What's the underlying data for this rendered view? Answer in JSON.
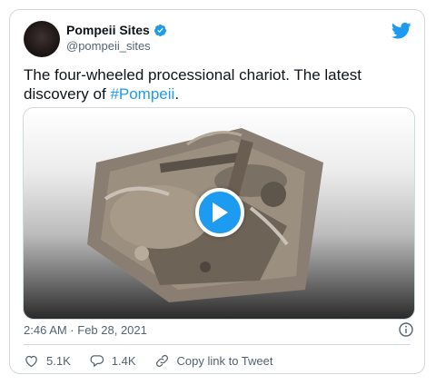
{
  "tweet": {
    "author": {
      "display_name": "Pompeii Sites",
      "handle": "@pompeii_sites",
      "verified": true,
      "avatar_icon": "pompeii-logo"
    },
    "text_main": "The four-wheeled processional chariot. The latest discovery of ",
    "hashtag": "#Pompeii",
    "text_end": ".",
    "timestamp": "2:46 AM · Feb 28, 2021",
    "actions": {
      "likes": "5.1K",
      "replies": "1.4K",
      "copy_link_label": "Copy link to Tweet"
    }
  },
  "colors": {
    "accent": "#1d9bf0",
    "secondary_text": "#536471",
    "border": "#cfd9de"
  },
  "icons": [
    "twitter-bird-icon",
    "verified-badge-icon",
    "play-icon",
    "info-icon",
    "heart-icon",
    "reply-icon",
    "link-icon"
  ]
}
